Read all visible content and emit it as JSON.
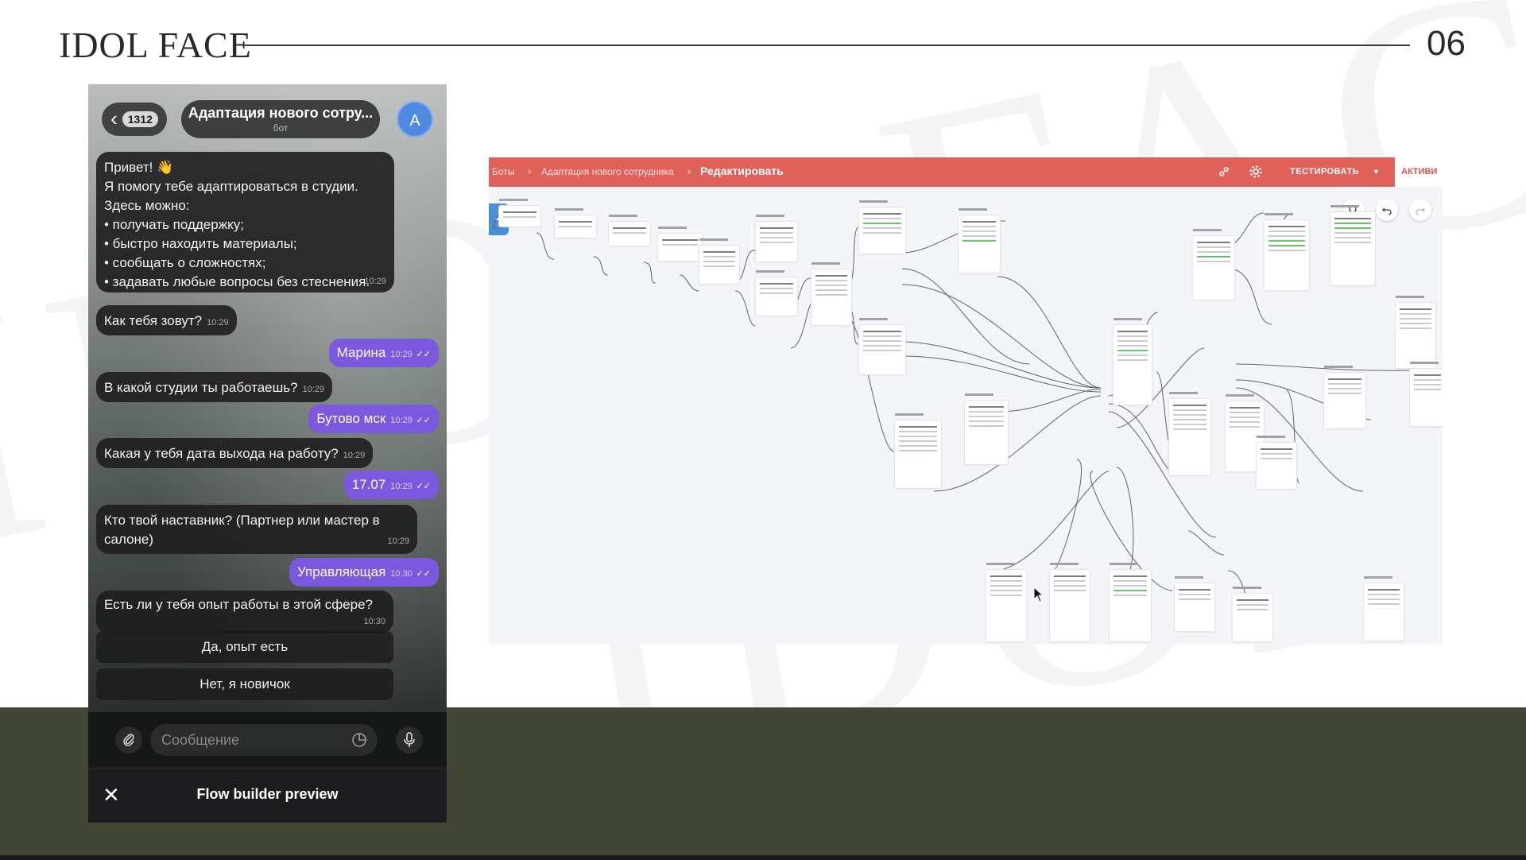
{
  "slide": {
    "logo": "IDOL FACE",
    "page_number": "06"
  },
  "phone": {
    "back_badge": "1312",
    "chat_title": "Адаптация нового сотру...",
    "chat_subtitle": "бот",
    "avatar_letter": "A",
    "messages": [
      {
        "dir": "in",
        "lines": [
          "Привет! 👋",
          "Я помогу тебе адаптироваться в студии.",
          "Здесь можно:",
          "• получать поддержку;",
          "• быстро находить материалы;",
          "• сообщать о сложностях;",
          "• задавать любые вопросы без стеснения."
        ],
        "time": "10:29"
      },
      {
        "dir": "in",
        "text": "Как тебя зовут?",
        "time": "10:29"
      },
      {
        "dir": "out",
        "text": "Марина",
        "time": "10:29"
      },
      {
        "dir": "in",
        "text": "В какой студии ты работаешь?",
        "time": "10:29"
      },
      {
        "dir": "out",
        "text": "Бутово мск",
        "time": "10:29"
      },
      {
        "dir": "in",
        "text": "Какая у тебя дата выхода на работу?",
        "time": "10:29"
      },
      {
        "dir": "out",
        "text": "17.07",
        "time": "10:29"
      },
      {
        "dir": "in",
        "lines": [
          "Кто твой наставник? (Партнер или мастер в",
          "салоне)"
        ],
        "time": "10:29"
      },
      {
        "dir": "out",
        "text": "Управляющая",
        "time": "10:30"
      },
      {
        "dir": "in",
        "text": "Есть ли у тебя опыт работы в этой сфере?",
        "time": "10:30"
      }
    ],
    "keyboard_buttons": [
      "Да, опыт есть",
      "Нет, я новичок"
    ],
    "input_placeholder": "Сообщение",
    "preview_title": "Flow builder preview"
  },
  "flow_builder": {
    "breadcrumb": [
      "Боты",
      "Адаптация нового сотрудника",
      "Редактировать"
    ],
    "test_label": "ТЕСТИРОВАТЬ",
    "active_label": "АКТИВИ",
    "accent_color": "#e0605a"
  }
}
